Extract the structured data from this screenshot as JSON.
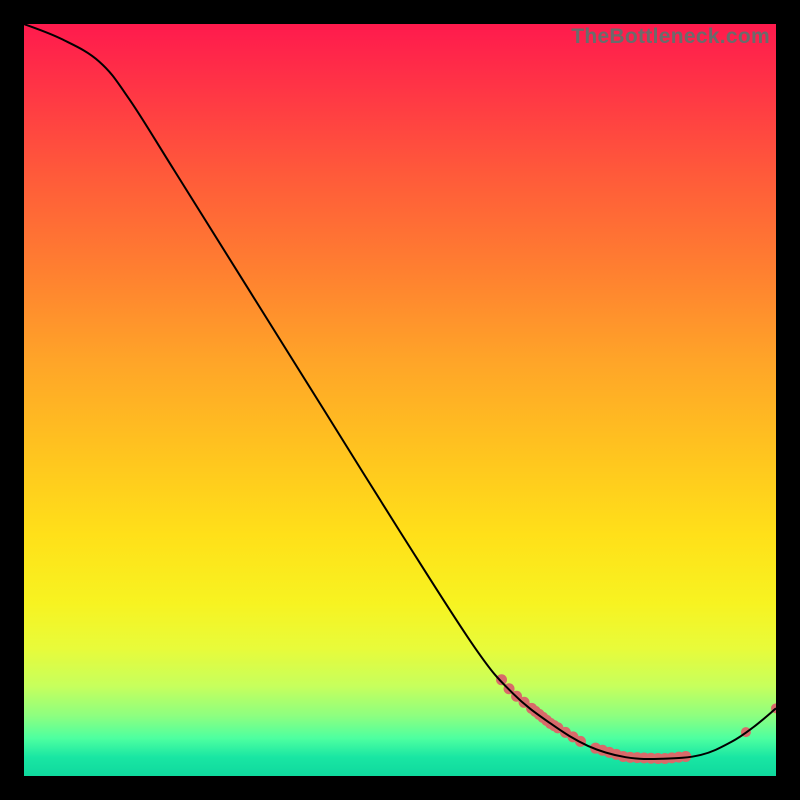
{
  "watermark": "TheBottleneck.com",
  "chart_data": {
    "type": "line",
    "title": "",
    "xlabel": "",
    "ylabel": "",
    "xlim": [
      0,
      100
    ],
    "ylim": [
      0,
      100
    ],
    "grid": false,
    "legend": false,
    "curve": [
      {
        "x": 0,
        "y": 100
      },
      {
        "x": 5,
        "y": 98
      },
      {
        "x": 10,
        "y": 95
      },
      {
        "x": 14,
        "y": 90
      },
      {
        "x": 20,
        "y": 80.5
      },
      {
        "x": 30,
        "y": 64.5
      },
      {
        "x": 40,
        "y": 48.5
      },
      {
        "x": 50,
        "y": 32.5
      },
      {
        "x": 60,
        "y": 17
      },
      {
        "x": 65,
        "y": 11
      },
      {
        "x": 70,
        "y": 7
      },
      {
        "x": 75,
        "y": 4
      },
      {
        "x": 80,
        "y": 2.5
      },
      {
        "x": 85,
        "y": 2.3
      },
      {
        "x": 90,
        "y": 2.8
      },
      {
        "x": 94,
        "y": 4.5
      },
      {
        "x": 97,
        "y": 6.5
      },
      {
        "x": 100,
        "y": 9
      }
    ],
    "marker_clusters": [
      {
        "x_center": 67,
        "y_center": 13,
        "count": 8,
        "spread": 3.5
      },
      {
        "x_center": 71,
        "y_center": 9,
        "count": 7,
        "spread": 3
      },
      {
        "x_center": 82,
        "y_center": 3.0,
        "count": 14,
        "spread": 6
      },
      {
        "x_center": 96,
        "y_center": 5.5,
        "count": 1,
        "spread": 0
      },
      {
        "x_center": 100,
        "y_center": 9,
        "count": 1,
        "spread": 0
      }
    ],
    "colors": {
      "curve": "#000000",
      "markers": "#d86a6a"
    }
  }
}
